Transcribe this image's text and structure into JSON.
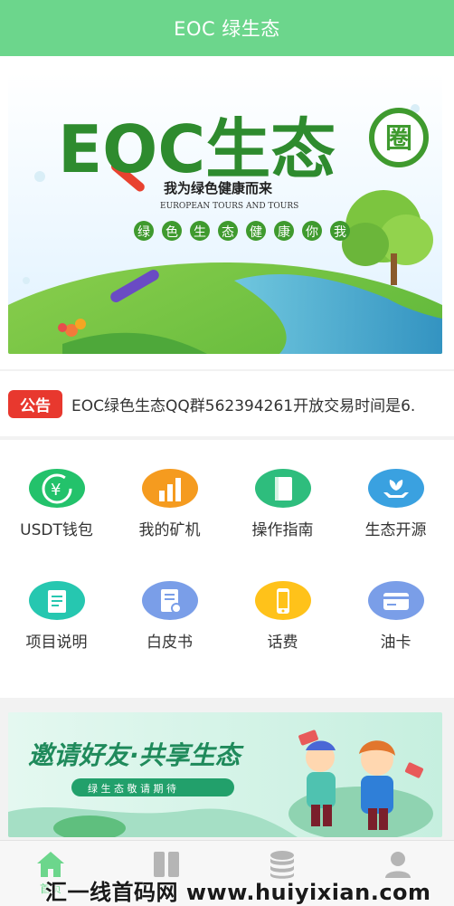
{
  "header": {
    "title": "EOC 绿生态"
  },
  "banner": {
    "logo_text": "EOC生态",
    "logo_circle_char": "圈",
    "slogan": "我为绿色健康而来",
    "subtitle": "EUROPEAN TOURS AND TOURS",
    "chips": [
      "绿",
      "色",
      "生",
      "态",
      "健",
      "康",
      "你",
      "我"
    ]
  },
  "notice": {
    "badge": "公告",
    "text": "EOC绿色生态QQ群562394261开放交易时间是6."
  },
  "menu": {
    "items": [
      {
        "label": "USDT钱包",
        "icon": "yen-wallet-icon",
        "color": "#23c26b"
      },
      {
        "label": "我的矿机",
        "icon": "bar-chart-icon",
        "color": "#f59b1f"
      },
      {
        "label": "操作指南",
        "icon": "book-icon",
        "color": "#2ebd7d"
      },
      {
        "label": "生态开源",
        "icon": "plant-hands-icon",
        "color": "#3aa1e0"
      },
      {
        "label": "项目说明",
        "icon": "document-icon",
        "color": "#26c7b0"
      },
      {
        "label": "白皮书",
        "icon": "whitepaper-icon",
        "color": "#7a9ee8"
      },
      {
        "label": "话费",
        "icon": "phone-icon",
        "color": "#ffc21a"
      },
      {
        "label": "油卡",
        "icon": "card-icon",
        "color": "#7a9ee8"
      }
    ]
  },
  "promo": {
    "title": "邀请好友·共享生态",
    "ribbon": "绿 生 态   敬 请 期 待"
  },
  "tabbar": {
    "items": [
      {
        "label": "首页",
        "icon": "home-icon",
        "active": true
      },
      {
        "label": "",
        "icon": "grid-icon",
        "active": false
      },
      {
        "label": "",
        "icon": "coins-icon",
        "active": false
      },
      {
        "label": "",
        "icon": "user-icon",
        "active": false
      }
    ],
    "active_color": "#6cd68c",
    "inactive_color": "#b5b5b5"
  },
  "watermark": {
    "text": "汇一线首码网 www.huiyixian.com"
  }
}
